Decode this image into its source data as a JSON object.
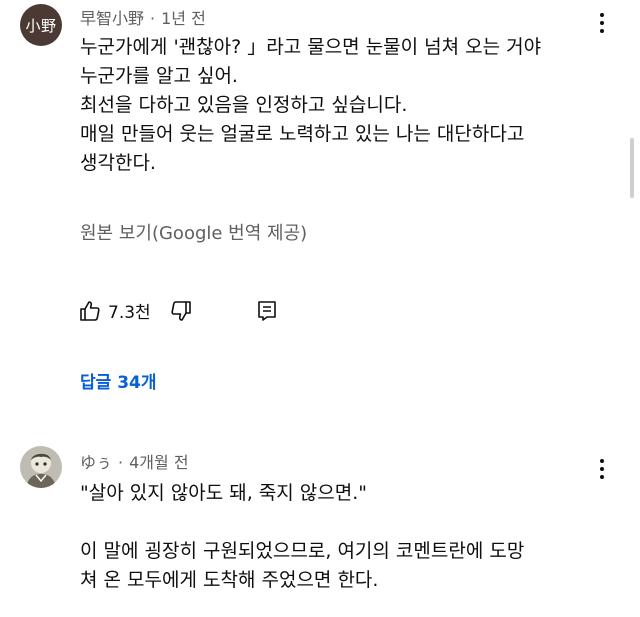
{
  "comments": [
    {
      "author": "早智小野",
      "avatar_text": "小野",
      "time": "1년 전",
      "lines": [
        "누군가에게 '괜찮아? 」라고 물으면 눈물이 넘쳐 오는 거야",
        "누군가를 알고 싶어.",
        "최선을 다하고 있음을 인정하고 싶습니다.",
        "매일 만들어 웃는 얼굴로 노력하고 있는 나는 대단하다고",
        "생각한다."
      ],
      "translate_label": "원본 보기(Google 번역 제공)",
      "like_count": "7.3천",
      "replies_label": "답글 34개"
    },
    {
      "author": "ゆぅ",
      "time": "4개월 전",
      "lines": [
        "\"살아 있지 않아도 돼, 죽지 않으면.\"",
        "",
        "이 말에 굉장히 구원되었으므로, 여기의 코멘트란에 도망",
        "쳐 온 모두에게 도착해 주었으면 한다."
      ]
    }
  ],
  "icons": {
    "more": "more-vert-icon",
    "like": "thumb-up-icon",
    "dislike": "thumb-down-icon",
    "reply": "comment-reply-icon"
  },
  "colors": {
    "replies": "#065fd4",
    "meta": "#606060"
  }
}
